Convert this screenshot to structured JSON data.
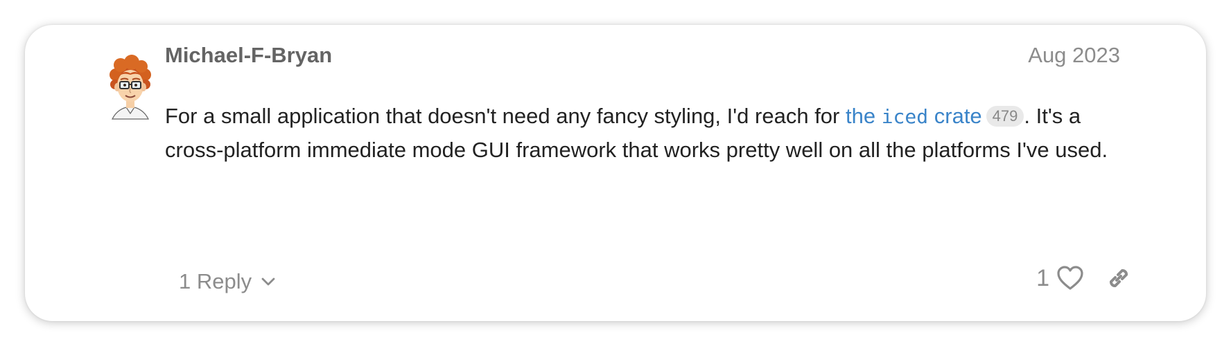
{
  "post": {
    "username": "Michael-F-Bryan",
    "date": "Aug 2023",
    "body": {
      "text_before": "For a small application that doesn't need any fancy styling, I'd reach for ",
      "link_prefix": "the ",
      "link_code": "iced",
      "link_suffix": " crate",
      "link_clicks": "479",
      "text_after": ". It's a cross-platform immediate mode GUI framework that works pretty well on all the platforms I've used."
    },
    "replies_label": "1 Reply",
    "like_count": "1"
  },
  "icons": {
    "avatar": "avatar-cartoon",
    "reply_toggle": "chevron-down-icon",
    "like": "heart-icon",
    "share": "link-icon"
  },
  "colors": {
    "link": "#3a84c9",
    "muted": "#8c8c8c",
    "username": "#646464",
    "body_text": "#222222"
  }
}
